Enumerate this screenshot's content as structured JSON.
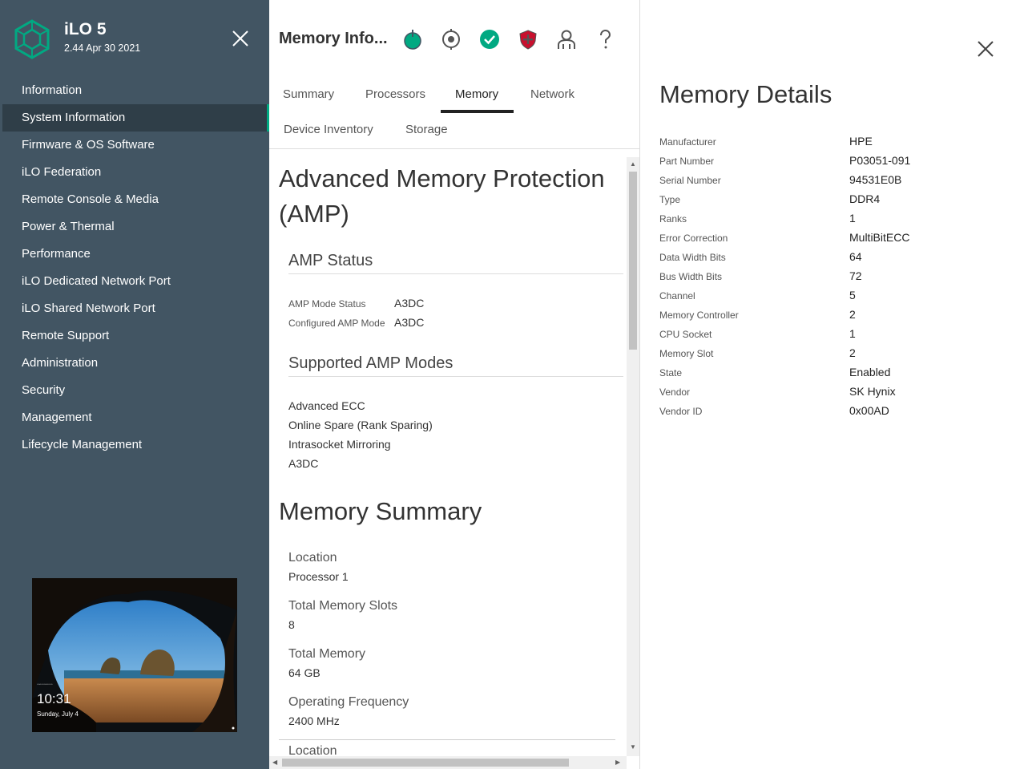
{
  "app": {
    "name": "iLO 5",
    "version": "2.44 Apr 30 2021"
  },
  "sidebar": {
    "items": [
      {
        "label": "Information"
      },
      {
        "label": "System Information",
        "active": true
      },
      {
        "label": "Firmware & OS Software"
      },
      {
        "label": "iLO Federation"
      },
      {
        "label": "Remote Console & Media"
      },
      {
        "label": "Power & Thermal"
      },
      {
        "label": "Performance"
      },
      {
        "label": "iLO Dedicated Network Port"
      },
      {
        "label": "iLO Shared Network Port"
      },
      {
        "label": "Remote Support"
      },
      {
        "label": "Administration"
      },
      {
        "label": "Security"
      },
      {
        "label": "Management"
      },
      {
        "label": "Lifecycle Management"
      }
    ],
    "console_preview": {
      "time": "10:31",
      "date": "Sunday, July 4"
    }
  },
  "header": {
    "title": "Memory Info...",
    "icons": [
      "power-on-icon",
      "uid-locator-icon",
      "health-ok-icon",
      "security-shield-icon",
      "user-icon",
      "help-icon"
    ]
  },
  "tabs": [
    {
      "label": "Summary"
    },
    {
      "label": "Processors"
    },
    {
      "label": "Memory",
      "active": true
    },
    {
      "label": "Network"
    },
    {
      "label": "Device Inventory"
    },
    {
      "label": "Storage"
    }
  ],
  "amp": {
    "heading": "Advanced Memory Protection (AMP)",
    "status_heading": "AMP Status",
    "status": [
      {
        "key": "AMP Mode Status",
        "value": "A3DC"
      },
      {
        "key": "Configured AMP Mode",
        "value": "A3DC"
      }
    ],
    "modes_heading": "Supported AMP Modes",
    "modes": [
      "Advanced ECC",
      "Online Spare (Rank Sparing)",
      "Intrasocket Mirroring",
      "A3DC"
    ]
  },
  "memory_summary": {
    "heading": "Memory Summary",
    "fields": [
      {
        "label": "Location",
        "value": "Processor 1"
      },
      {
        "label": "Total Memory Slots",
        "value": "8"
      },
      {
        "label": "Total Memory",
        "value": "64 GB"
      },
      {
        "label": "Operating Frequency",
        "value": "2400 MHz"
      }
    ],
    "next_label": "Location"
  },
  "memory_details": {
    "title": "Memory Details",
    "rows": [
      {
        "key": "Manufacturer",
        "value": "HPE"
      },
      {
        "key": "Part Number",
        "value": "P03051-091"
      },
      {
        "key": "Serial Number",
        "value": "94531E0B"
      },
      {
        "key": "Type",
        "value": "DDR4"
      },
      {
        "key": "Ranks",
        "value": "1"
      },
      {
        "key": "Error Correction",
        "value": "MultiBitECC"
      },
      {
        "key": "Data Width Bits",
        "value": "64"
      },
      {
        "key": "Bus Width Bits",
        "value": "72"
      },
      {
        "key": "Channel",
        "value": "5"
      },
      {
        "key": "Memory Controller",
        "value": "2"
      },
      {
        "key": "CPU Socket",
        "value": "1"
      },
      {
        "key": "Memory Slot",
        "value": "2"
      },
      {
        "key": "State",
        "value": "Enabled"
      },
      {
        "key": "Vendor",
        "value": "SK Hynix"
      },
      {
        "key": "Vendor ID",
        "value": "0x00AD"
      }
    ]
  },
  "colors": {
    "sidebar_bg": "#425563",
    "active_item_bg": "#2f3e48",
    "accent_green": "#01a982",
    "shield_red": "#c8102e"
  }
}
